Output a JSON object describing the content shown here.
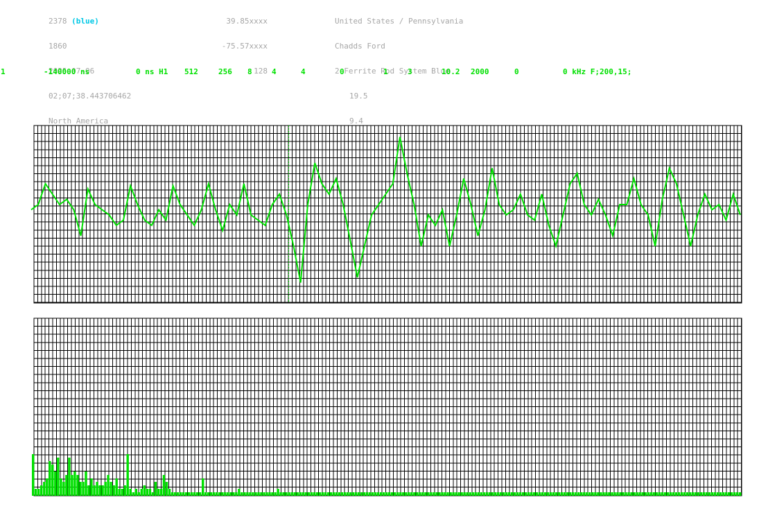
{
  "header": {
    "col1": {
      "station_id": "2378",
      "station_color": "(blue)",
      "line2": "1860",
      "date": "2025-07-06",
      "time": "02;07;38.443706462",
      "region": "North America"
    },
    "col2": {
      "lat": "39.85xxxx",
      "lon": "-75.57xxxx",
      "value": "128"
    },
    "col3": {
      "location": "United States / Pennsylvania",
      "city": "Chadds Ford",
      "system": "2 Ferrite Rod System Blue",
      "val1": "19.5",
      "val2": "9.4"
    }
  },
  "params": [
    "1",
    "-140000 ns",
    "0 ns H1",
    "512",
    "256",
    "8",
    "4",
    "4",
    "0",
    "1",
    "3",
    "10.2",
    "2000",
    "0",
    "0 kHz F;200,15;"
  ],
  "colors": {
    "trace": "#00e000",
    "header_text": "#a6a6a6",
    "station_accent": "#00c8e6",
    "grid": "#000000"
  },
  "chart_data": [
    {
      "type": "line",
      "description_series": "waveform",
      "x_range": [
        0,
        100
      ],
      "y_range": [
        -1,
        1
      ],
      "grid": true,
      "cursor_x": 36,
      "samples": [
        0.05,
        0.1,
        0.3,
        0.2,
        0.1,
        0.15,
        0.05,
        -0.2,
        0.25,
        0.1,
        0.05,
        0.0,
        -0.1,
        -0.05,
        0.28,
        0.1,
        -0.05,
        -0.1,
        0.05,
        -0.05,
        0.28,
        0.1,
        0.0,
        -0.1,
        0.05,
        0.3,
        0.05,
        -0.15,
        0.1,
        0.0,
        0.3,
        0.0,
        -0.05,
        -0.1,
        0.1,
        0.2,
        0.0,
        -0.3,
        -0.65,
        0.1,
        0.5,
        0.3,
        0.2,
        0.35,
        0.1,
        -0.25,
        -0.6,
        -0.3,
        0.0,
        0.1,
        0.2,
        0.3,
        0.75,
        0.4,
        0.1,
        -0.3,
        0.0,
        -0.1,
        0.05,
        -0.3,
        0.0,
        0.35,
        0.1,
        -0.2,
        0.05,
        0.45,
        0.1,
        0.0,
        0.05,
        0.2,
        0.0,
        -0.05,
        0.2,
        -0.1,
        -0.3,
        0.0,
        0.3,
        0.4,
        0.1,
        0.0,
        0.15,
        0.0,
        -0.2,
        0.1,
        0.1,
        0.35,
        0.1,
        0.0,
        -0.3,
        0.15,
        0.45,
        0.3,
        0.0,
        -0.3,
        0.0,
        0.2,
        0.05,
        0.1,
        -0.05,
        0.2,
        0.0
      ]
    },
    {
      "type": "bar",
      "description_series": "spectrum",
      "y_range": [
        0,
        1
      ],
      "grid": true,
      "values": [
        0.6,
        0.1,
        0.1,
        0.15,
        0.2,
        0.25,
        0.5,
        0.45,
        0.35,
        0.55,
        0.25,
        0.2,
        0.3,
        0.55,
        0.3,
        0.35,
        0.3,
        0.2,
        0.2,
        0.35,
        0.15,
        0.25,
        0.15,
        0.2,
        0.15,
        0.15,
        0.2,
        0.3,
        0.2,
        0.15,
        0.25,
        0.1,
        0.1,
        0.15,
        0.6,
        0.1,
        0.05,
        0.1,
        0.05,
        0.1,
        0.15,
        0.1,
        0.1,
        0.05,
        0.2,
        0.1,
        0.1,
        0.3,
        0.2,
        0.1,
        0.05,
        0.05,
        0.05,
        0.05,
        0.05,
        0.05,
        0.05,
        0.05,
        0.05,
        0.05,
        0.05,
        0.25,
        0.05,
        0.05,
        0.05,
        0.05,
        0.05,
        0.05,
        0.05,
        0.05,
        0.05,
        0.05,
        0.05,
        0.05,
        0.1,
        0.05,
        0.05,
        0.05,
        0.05,
        0.05,
        0.05,
        0.05,
        0.05,
        0.05,
        0.05,
        0.05,
        0.05,
        0.05,
        0.1,
        0.05,
        0.05,
        0.05,
        0.05,
        0.05,
        0.05,
        0.05,
        0.05,
        0.05,
        0.05,
        0.05,
        0.05,
        0.05,
        0.05,
        0.05,
        0.05,
        0.05,
        0.05,
        0.05,
        0.05,
        0.05,
        0.05,
        0.05,
        0.05,
        0.05,
        0.05,
        0.05,
        0.05,
        0.05,
        0.05,
        0.05,
        0.05,
        0.05,
        0.05,
        0.05,
        0.05,
        0.05,
        0.05,
        0.05,
        0.05,
        0.05,
        0.05,
        0.05,
        0.05,
        0.05,
        0.05,
        0.05,
        0.05,
        0.05,
        0.05,
        0.05,
        0.05,
        0.05,
        0.05,
        0.05,
        0.05,
        0.05,
        0.05,
        0.05,
        0.05,
        0.05,
        0.05,
        0.05,
        0.05,
        0.05,
        0.05,
        0.05,
        0.05,
        0.05,
        0.05,
        0.05,
        0.05,
        0.05,
        0.05,
        0.05,
        0.05,
        0.05,
        0.05,
        0.05,
        0.05,
        0.05,
        0.05,
        0.05,
        0.05,
        0.05,
        0.05,
        0.05,
        0.05,
        0.05,
        0.05,
        0.05,
        0.05,
        0.05,
        0.05,
        0.05,
        0.05,
        0.05,
        0.05,
        0.05,
        0.05,
        0.05,
        0.05,
        0.05,
        0.05,
        0.05,
        0.05,
        0.05,
        0.05,
        0.05,
        0.05,
        0.05,
        0.05,
        0.05,
        0.05,
        0.05,
        0.05,
        0.05,
        0.05,
        0.05,
        0.05,
        0.05,
        0.05,
        0.05,
        0.05,
        0.05,
        0.05,
        0.05,
        0.05,
        0.05,
        0.05,
        0.05,
        0.05,
        0.05,
        0.05,
        0.05,
        0.05,
        0.05,
        0.05,
        0.05,
        0.05,
        0.05,
        0.05,
        0.05,
        0.05,
        0.05,
        0.05,
        0.05,
        0.05,
        0.05,
        0.05,
        0.05,
        0.05,
        0.05,
        0.05,
        0.05,
        0.05,
        0.05,
        0.05,
        0.05,
        0.05,
        0.05,
        0.05,
        0.05,
        0.05,
        0.05,
        0.05
      ]
    }
  ]
}
